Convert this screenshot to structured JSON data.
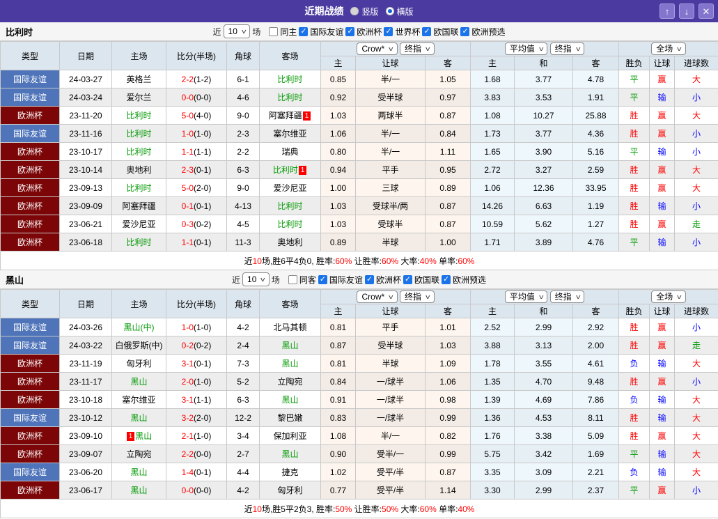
{
  "titlebar": {
    "title": "近期战绩",
    "vertical_label": "竖版",
    "horizontal_label": "横版",
    "selected_layout": "横版"
  },
  "colors": {
    "titlebar_bg": "#4b3ba0",
    "titlebar_button_bg": "#8375cd",
    "badge_friendly_blue": "#4f74ba",
    "badge_eurocup_maroon": "#7b0507",
    "focal_team_green": "#009900",
    "win_red": "#ff0000",
    "lose_blue": "#0000ff",
    "checkbox_blue": "#1a73e8",
    "header_bg": "#dce6ee"
  },
  "filter_labels": {
    "near": "近",
    "games": "场"
  },
  "table_header": {
    "cols": [
      "类型",
      "日期",
      "主场",
      "比分(半场)",
      "角球",
      "客场"
    ],
    "dropdown_crow": "Crow*",
    "dropdown_final1": "终指",
    "dropdown_avg": "平均值",
    "dropdown_final2": "终指",
    "dropdown_full": "全场",
    "sub_cols": [
      "主",
      "让球",
      "客",
      "主",
      "和",
      "客",
      "胜负",
      "让球",
      "进球数"
    ]
  },
  "sections": [
    {
      "team": "比利时",
      "count": "10",
      "same_label": "同主",
      "leagues": [
        "国际友谊",
        "欧洲杯",
        "世界杯",
        "欧国联",
        "欧洲预选"
      ],
      "rows": [
        {
          "type": "国际友谊",
          "tc": "b",
          "date": "24-03-27",
          "home": "英格兰",
          "hg": false,
          "hb": "",
          "hbPre": false,
          "score": "2-2",
          "half": "(1-2)",
          "corner": "6-1",
          "away": "比利时",
          "ag": true,
          "ab": "",
          "o1": "0.85",
          "h": "半/一",
          "o2": "1.05",
          "a1": "1.68",
          "a2": "3.77",
          "a3": "4.78",
          "r1": "平",
          "c1": "g",
          "r2": "赢",
          "c2": "r",
          "r3": "大",
          "c3": "r"
        },
        {
          "type": "国际友谊",
          "tc": "b",
          "date": "24-03-24",
          "home": "爱尔兰",
          "hg": false,
          "hb": "",
          "hbPre": false,
          "score": "0-0",
          "half": "(0-0)",
          "corner": "4-6",
          "away": "比利时",
          "ag": true,
          "ab": "",
          "o1": "0.92",
          "h": "受半球",
          "o2": "0.97",
          "a1": "3.83",
          "a2": "3.53",
          "a3": "1.91",
          "r1": "平",
          "c1": "g",
          "r2": "输",
          "c2": "b",
          "r3": "小",
          "c3": "b"
        },
        {
          "type": "欧洲杯",
          "tc": "m",
          "date": "23-11-20",
          "home": "比利时",
          "hg": true,
          "hb": "",
          "hbPre": false,
          "score": "5-0",
          "half": "(4-0)",
          "corner": "9-0",
          "away": "阿塞拜疆",
          "ag": false,
          "ab": "1",
          "o1": "1.03",
          "h": "两球半",
          "o2": "0.87",
          "a1": "1.08",
          "a2": "10.27",
          "a3": "25.88",
          "r1": "胜",
          "c1": "r",
          "r2": "赢",
          "c2": "r",
          "r3": "大",
          "c3": "r"
        },
        {
          "type": "国际友谊",
          "tc": "b",
          "date": "23-11-16",
          "home": "比利时",
          "hg": true,
          "hb": "",
          "hbPre": false,
          "score": "1-0",
          "half": "(1-0)",
          "corner": "2-3",
          "away": "塞尔维亚",
          "ag": false,
          "ab": "",
          "o1": "1.06",
          "h": "半/一",
          "o2": "0.84",
          "a1": "1.73",
          "a2": "3.77",
          "a3": "4.36",
          "r1": "胜",
          "c1": "r",
          "r2": "赢",
          "c2": "r",
          "r3": "小",
          "c3": "b"
        },
        {
          "type": "欧洲杯",
          "tc": "m",
          "date": "23-10-17",
          "home": "比利时",
          "hg": true,
          "hb": "",
          "hbPre": false,
          "score": "1-1",
          "half": "(1-1)",
          "corner": "2-2",
          "away": "瑞典",
          "ag": false,
          "ab": "",
          "o1": "0.80",
          "h": "半/一",
          "o2": "1.11",
          "a1": "1.65",
          "a2": "3.90",
          "a3": "5.16",
          "r1": "平",
          "c1": "g",
          "r2": "输",
          "c2": "b",
          "r3": "小",
          "c3": "b"
        },
        {
          "type": "欧洲杯",
          "tc": "m",
          "date": "23-10-14",
          "home": "奥地利",
          "hg": false,
          "hb": "",
          "hbPre": false,
          "score": "2-3",
          "half": "(0-1)",
          "corner": "6-3",
          "away": "比利时",
          "ag": true,
          "ab": "1",
          "o1": "0.94",
          "h": "平手",
          "o2": "0.95",
          "a1": "2.72",
          "a2": "3.27",
          "a3": "2.59",
          "r1": "胜",
          "c1": "r",
          "r2": "赢",
          "c2": "r",
          "r3": "大",
          "c3": "r"
        },
        {
          "type": "欧洲杯",
          "tc": "m",
          "date": "23-09-13",
          "home": "比利时",
          "hg": true,
          "hb": "",
          "hbPre": false,
          "score": "5-0",
          "half": "(2-0)",
          "corner": "9-0",
          "away": "爱沙尼亚",
          "ag": false,
          "ab": "",
          "o1": "1.00",
          "h": "三球",
          "o2": "0.89",
          "a1": "1.06",
          "a2": "12.36",
          "a3": "33.95",
          "r1": "胜",
          "c1": "r",
          "r2": "赢",
          "c2": "r",
          "r3": "大",
          "c3": "r"
        },
        {
          "type": "欧洲杯",
          "tc": "m",
          "date": "23-09-09",
          "home": "阿塞拜疆",
          "hg": false,
          "hb": "",
          "hbPre": false,
          "score": "0-1",
          "half": "(0-1)",
          "corner": "4-13",
          "away": "比利时",
          "ag": true,
          "ab": "",
          "o1": "1.03",
          "h": "受球半/两",
          "o2": "0.87",
          "a1": "14.26",
          "a2": "6.63",
          "a3": "1.19",
          "r1": "胜",
          "c1": "r",
          "r2": "输",
          "c2": "b",
          "r3": "小",
          "c3": "b"
        },
        {
          "type": "欧洲杯",
          "tc": "m",
          "date": "23-06-21",
          "home": "爱沙尼亚",
          "hg": false,
          "hb": "",
          "hbPre": false,
          "score": "0-3",
          "half": "(0-2)",
          "corner": "4-5",
          "away": "比利时",
          "ag": true,
          "ab": "",
          "o1": "1.03",
          "h": "受球半",
          "o2": "0.87",
          "a1": "10.59",
          "a2": "5.62",
          "a3": "1.27",
          "r1": "胜",
          "c1": "r",
          "r2": "赢",
          "c2": "r",
          "r3": "走",
          "c3": "g"
        },
        {
          "type": "欧洲杯",
          "tc": "m",
          "date": "23-06-18",
          "home": "比利时",
          "hg": true,
          "hb": "",
          "hbPre": false,
          "score": "1-1",
          "half": "(0-1)",
          "corner": "11-3",
          "away": "奥地利",
          "ag": false,
          "ab": "",
          "o1": "0.89",
          "h": "半球",
          "o2": "1.00",
          "a1": "1.71",
          "a2": "3.89",
          "a3": "4.76",
          "r1": "平",
          "c1": "g",
          "r2": "输",
          "c2": "b",
          "r3": "小",
          "c3": "b"
        }
      ],
      "summary": [
        {
          "t": "近",
          "c": "k"
        },
        {
          "t": "10",
          "c": "r"
        },
        {
          "t": "场,胜6平4负0, 胜率:",
          "c": "k"
        },
        {
          "t": "60%",
          "c": "r"
        },
        {
          "t": " 让胜率:",
          "c": "k"
        },
        {
          "t": "60%",
          "c": "r"
        },
        {
          "t": " 大率:",
          "c": "k"
        },
        {
          "t": "40%",
          "c": "r"
        },
        {
          "t": " 单率:",
          "c": "k"
        },
        {
          "t": "60%",
          "c": "r"
        }
      ]
    },
    {
      "team": "黑山",
      "count": "10",
      "same_label": "同客",
      "leagues": [
        "国际友谊",
        "欧洲杯",
        "欧国联",
        "欧洲预选"
      ],
      "rows": [
        {
          "type": "国际友谊",
          "tc": "b",
          "date": "24-03-26",
          "home": "黑山(中)",
          "hg": true,
          "hb": "",
          "hbPre": false,
          "score": "1-0",
          "half": "(1-0)",
          "corner": "4-2",
          "away": "北马其顿",
          "ag": false,
          "ab": "",
          "o1": "0.81",
          "h": "平手",
          "o2": "1.01",
          "a1": "2.52",
          "a2": "2.99",
          "a3": "2.92",
          "r1": "胜",
          "c1": "r",
          "r2": "赢",
          "c2": "r",
          "r3": "小",
          "c3": "b"
        },
        {
          "type": "国际友谊",
          "tc": "b",
          "date": "24-03-22",
          "home": "白俄罗斯(中)",
          "hg": false,
          "hb": "",
          "hbPre": false,
          "score": "0-2",
          "half": "(0-2)",
          "corner": "2-4",
          "away": "黑山",
          "ag": true,
          "ab": "",
          "o1": "0.87",
          "h": "受半球",
          "o2": "1.03",
          "a1": "3.88",
          "a2": "3.13",
          "a3": "2.00",
          "r1": "胜",
          "c1": "r",
          "r2": "赢",
          "c2": "r",
          "r3": "走",
          "c3": "g"
        },
        {
          "type": "欧洲杯",
          "tc": "m",
          "date": "23-11-19",
          "home": "匈牙利",
          "hg": false,
          "hb": "",
          "hbPre": false,
          "score": "3-1",
          "half": "(0-1)",
          "corner": "7-3",
          "away": "黑山",
          "ag": true,
          "ab": "",
          "o1": "0.81",
          "h": "半球",
          "o2": "1.09",
          "a1": "1.78",
          "a2": "3.55",
          "a3": "4.61",
          "r1": "负",
          "c1": "b",
          "r2": "输",
          "c2": "b",
          "r3": "大",
          "c3": "r"
        },
        {
          "type": "欧洲杯",
          "tc": "m",
          "date": "23-11-17",
          "home": "黑山",
          "hg": true,
          "hb": "",
          "hbPre": false,
          "score": "2-0",
          "half": "(1-0)",
          "corner": "5-2",
          "away": "立陶宛",
          "ag": false,
          "ab": "",
          "o1": "0.84",
          "h": "一/球半",
          "o2": "1.06",
          "a1": "1.35",
          "a2": "4.70",
          "a3": "9.48",
          "r1": "胜",
          "c1": "r",
          "r2": "赢",
          "c2": "r",
          "r3": "小",
          "c3": "b"
        },
        {
          "type": "欧洲杯",
          "tc": "m",
          "date": "23-10-18",
          "home": "塞尔维亚",
          "hg": false,
          "hb": "",
          "hbPre": false,
          "score": "3-1",
          "half": "(1-1)",
          "corner": "6-3",
          "away": "黑山",
          "ag": true,
          "ab": "",
          "o1": "0.91",
          "h": "一/球半",
          "o2": "0.98",
          "a1": "1.39",
          "a2": "4.69",
          "a3": "7.86",
          "r1": "负",
          "c1": "b",
          "r2": "输",
          "c2": "b",
          "r3": "大",
          "c3": "r"
        },
        {
          "type": "国际友谊",
          "tc": "b",
          "date": "23-10-12",
          "home": "黑山",
          "hg": true,
          "hb": "",
          "hbPre": false,
          "score": "3-2",
          "half": "(2-0)",
          "corner": "12-2",
          "away": "黎巴嫩",
          "ag": false,
          "ab": "",
          "o1": "0.83",
          "h": "一/球半",
          "o2": "0.99",
          "a1": "1.36",
          "a2": "4.53",
          "a3": "8.11",
          "r1": "胜",
          "c1": "r",
          "r2": "输",
          "c2": "b",
          "r3": "大",
          "c3": "r"
        },
        {
          "type": "欧洲杯",
          "tc": "m",
          "date": "23-09-10",
          "home": "黑山",
          "hg": true,
          "hb": "1",
          "hbPre": true,
          "score": "2-1",
          "half": "(1-0)",
          "corner": "3-4",
          "away": "保加利亚",
          "ag": false,
          "ab": "",
          "o1": "1.08",
          "h": "半/一",
          "o2": "0.82",
          "a1": "1.76",
          "a2": "3.38",
          "a3": "5.09",
          "r1": "胜",
          "c1": "r",
          "r2": "赢",
          "c2": "r",
          "r3": "大",
          "c3": "r"
        },
        {
          "type": "欧洲杯",
          "tc": "m",
          "date": "23-09-07",
          "home": "立陶宛",
          "hg": false,
          "hb": "",
          "hbPre": false,
          "score": "2-2",
          "half": "(0-0)",
          "corner": "2-7",
          "away": "黑山",
          "ag": true,
          "ab": "",
          "o1": "0.90",
          "h": "受半/一",
          "o2": "0.99",
          "a1": "5.75",
          "a2": "3.42",
          "a3": "1.69",
          "r1": "平",
          "c1": "g",
          "r2": "输",
          "c2": "b",
          "r3": "大",
          "c3": "r"
        },
        {
          "type": "国际友谊",
          "tc": "b",
          "date": "23-06-20",
          "home": "黑山",
          "hg": true,
          "hb": "",
          "hbPre": false,
          "score": "1-4",
          "half": "(0-1)",
          "corner": "4-4",
          "away": "捷克",
          "ag": false,
          "ab": "",
          "o1": "1.02",
          "h": "受平/半",
          "o2": "0.87",
          "a1": "3.35",
          "a2": "3.09",
          "a3": "2.21",
          "r1": "负",
          "c1": "b",
          "r2": "输",
          "c2": "b",
          "r3": "大",
          "c3": "r"
        },
        {
          "type": "欧洲杯",
          "tc": "m",
          "date": "23-06-17",
          "home": "黑山",
          "hg": true,
          "hb": "",
          "hbPre": false,
          "score": "0-0",
          "half": "(0-0)",
          "corner": "4-2",
          "away": "匈牙利",
          "ag": false,
          "ab": "",
          "o1": "0.77",
          "h": "受平/半",
          "o2": "1.14",
          "a1": "3.30",
          "a2": "2.99",
          "a3": "2.37",
          "r1": "平",
          "c1": "g",
          "r2": "赢",
          "c2": "r",
          "r3": "小",
          "c3": "b"
        }
      ],
      "summary": [
        {
          "t": "近",
          "c": "k"
        },
        {
          "t": "10",
          "c": "r"
        },
        {
          "t": "场,胜5平2负3, 胜率:",
          "c": "k"
        },
        {
          "t": "50%",
          "c": "r"
        },
        {
          "t": " 让胜率:",
          "c": "k"
        },
        {
          "t": "50%",
          "c": "r"
        },
        {
          "t": " 大率:",
          "c": "k"
        },
        {
          "t": "60%",
          "c": "r"
        },
        {
          "t": " 单率:",
          "c": "k"
        },
        {
          "t": "40%",
          "c": "r"
        }
      ]
    }
  ]
}
